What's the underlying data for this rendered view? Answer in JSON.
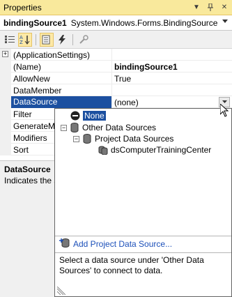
{
  "window": {
    "title": "Properties"
  },
  "object_selector": {
    "name": "bindingSource1",
    "type": "System.Windows.Forms.BindingSource"
  },
  "properties": [
    {
      "name": "(ApplicationSettings)",
      "value": "",
      "category": true
    },
    {
      "name": "(Name)",
      "value": "bindingSource1",
      "bold": true
    },
    {
      "name": "AllowNew",
      "value": "True"
    },
    {
      "name": "DataMember",
      "value": ""
    },
    {
      "name": "DataSource",
      "value": "(none)",
      "selected": true
    },
    {
      "name": "Filter",
      "value": ""
    },
    {
      "name": "GenerateMember",
      "value": ""
    },
    {
      "name": "Modifiers",
      "value": ""
    },
    {
      "name": "Sort",
      "value": ""
    }
  ],
  "description": {
    "title": "DataSource",
    "text": "Indicates the source of data for the BindingSource."
  },
  "popup": {
    "tree": [
      {
        "label": "None",
        "selected": true,
        "icon": "none-icon"
      },
      {
        "label": "Other Data Sources",
        "icon": "database-icon",
        "glyph": "−"
      },
      {
        "label": "Project Data Sources",
        "icon": "database-icon",
        "glyph": "−"
      },
      {
        "label": "dsComputerTrainingCenter",
        "icon": "dataset-icon"
      }
    ],
    "add_link": "Add Project Data Source...",
    "hint": "Select a data source under 'Other Data Sources' to connect to data."
  },
  "colors": {
    "title_bg": "#f9e99c",
    "selection": "#1c50a0",
    "link": "#1b4fb9"
  }
}
